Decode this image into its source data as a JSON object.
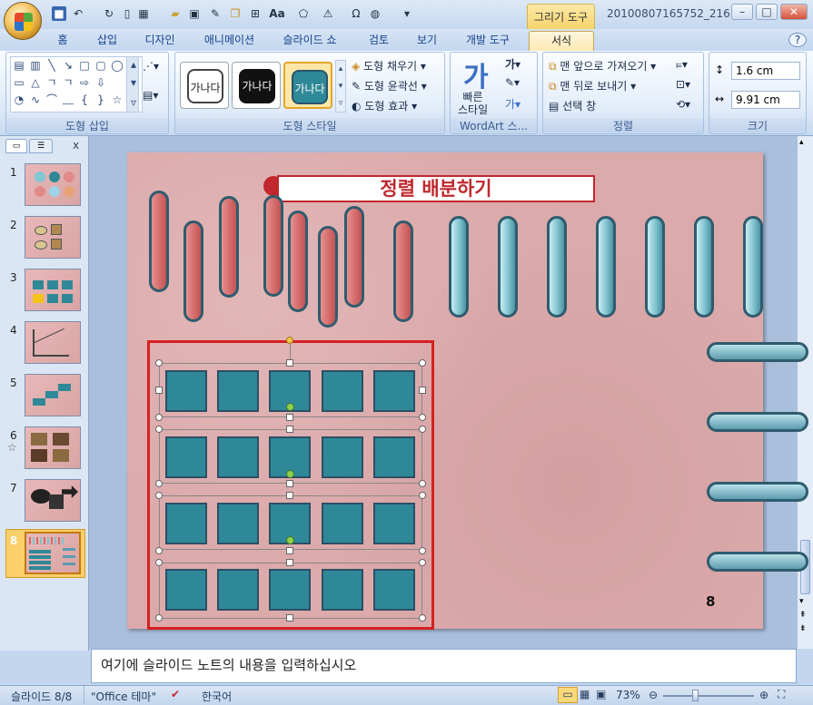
{
  "window": {
    "context_tab_group": "그리기 도구",
    "doc_title": "20100807165752_216...",
    "quick_access_icons": [
      "save-icon",
      "undo-icon",
      "redo-icon",
      "new-icon",
      "table-icon",
      "folder-icon",
      "image-icon",
      "edit-icon",
      "copy-icon",
      "format-icon",
      "font-icon",
      "shape-icon",
      "text-direction-icon",
      "symbol-icon",
      "paint-icon",
      "dropdown-icon"
    ],
    "buttons": {
      "minimize": "–",
      "maximize": "□",
      "close": "✕",
      "help": "?"
    }
  },
  "tabs": [
    {
      "label": "홈",
      "active": false
    },
    {
      "label": "삽입",
      "active": false
    },
    {
      "label": "디자인",
      "active": false
    },
    {
      "label": "애니메이션",
      "active": false
    },
    {
      "label": "슬라이드 쇼",
      "active": false
    },
    {
      "label": "검토",
      "active": false
    },
    {
      "label": "보기",
      "active": false
    },
    {
      "label": "개발 도구",
      "active": false
    },
    {
      "label": "서식",
      "active": true
    }
  ],
  "ribbon": {
    "insert_shapes": {
      "label": "도형 삽입"
    },
    "shape_styles": {
      "label": "도형 스타일",
      "swatch_text": "가나다",
      "fill": "도형 채우기",
      "outline": "도형 윤곽선",
      "effects": "도형 효과"
    },
    "wordart": {
      "label": "WordArt 스...",
      "quick_style": "빠른\n스타일",
      "glyph": "가"
    },
    "arrange": {
      "label": "정렬",
      "bring_front": "맨 앞으로 가져오기",
      "send_back": "맨 뒤로 보내기",
      "selection_pane": "선택 창"
    },
    "size": {
      "label": "크기",
      "height": "1.6 cm",
      "width": "9.91 cm"
    }
  },
  "slides_pane": {
    "close": "x",
    "slides": [
      {
        "num": "1"
      },
      {
        "num": "2"
      },
      {
        "num": "3"
      },
      {
        "num": "4"
      },
      {
        "num": "5"
      },
      {
        "num": "6"
      },
      {
        "num": "7"
      },
      {
        "num": "8",
        "selected": true
      }
    ]
  },
  "slide": {
    "title": "정렬 배분하기",
    "page_number": "8"
  },
  "notes": {
    "placeholder": "여기에 슬라이드 노트의 내용을 입력하십시오"
  },
  "status": {
    "slide_info": "슬라이드 8/8",
    "theme": "\"Office 테마\"",
    "language": "한국어",
    "zoom": "73%",
    "zoom_level": 0.73
  },
  "colors": {
    "accent_teal": "#2f8898",
    "title_red": "#c0282d",
    "selection_red": "#d62020"
  }
}
